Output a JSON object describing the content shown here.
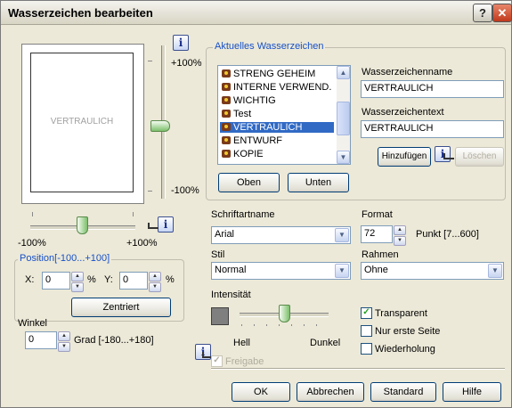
{
  "window": {
    "title": "Wasserzeichen bearbeiten",
    "help_label": "?",
    "close_label": "✕"
  },
  "info_icon": "i",
  "preview": {
    "watermark_text": "VERTRAULICH",
    "vertical_slider": {
      "max_label": "+100%",
      "min_label": "-100%",
      "value_percent": 0
    },
    "horizontal_slider": {
      "min_label": "-100%",
      "max_label": "+100%",
      "value_percent": 0
    }
  },
  "position": {
    "legend": "Position[-100...+100]",
    "x_label": "X:",
    "x_value": "0",
    "x_unit": "%",
    "y_label": "Y:",
    "y_value": "0",
    "y_unit": "%",
    "center_button": "Zentriert"
  },
  "angle": {
    "label": "Winkel",
    "value": "0",
    "unit_label": "Grad [-180...+180]"
  },
  "current": {
    "legend": "Aktuelles Wasserzeichen",
    "items": [
      {
        "label": "STRENG GEHEIM"
      },
      {
        "label": "INTERNE VERWEND."
      },
      {
        "label": "WICHTIG"
      },
      {
        "label": "Test"
      },
      {
        "label": "VERTRAULICH"
      },
      {
        "label": "ENTWURF"
      },
      {
        "label": "KOPIE"
      }
    ],
    "selected_index": 4,
    "top_button": "Oben",
    "bottom_button": "Unten",
    "name_label": "Wasserzeichenname",
    "name_value": "VERTRAULICH",
    "text_label": "Wasserzeichentext",
    "text_value": "VERTRAULICH",
    "add_button": "Hinzufügen",
    "delete_button": "Löschen"
  },
  "font": {
    "label": "Schriftartname",
    "value": "Arial"
  },
  "format": {
    "label": "Format",
    "value": "72",
    "unit_label": "Punkt [7...600]"
  },
  "style": {
    "label": "Stil",
    "value": "Normal"
  },
  "frame": {
    "label": "Rahmen",
    "value": "Ohne"
  },
  "intensity": {
    "label": "Intensität",
    "light_label": "Hell",
    "dark_label": "Dunkel",
    "value_percent": 30,
    "swatch_color": "#7f7f7f"
  },
  "options": {
    "transparent": {
      "label": "Transparent",
      "checked": true
    },
    "first_page_only": {
      "label": "Nur erste Seite",
      "checked": false
    },
    "repeat": {
      "label": "Wiederholung",
      "checked": false
    },
    "share": {
      "label": "Freigabe",
      "checked": true,
      "disabled": true
    }
  },
  "buttons": {
    "ok": "OK",
    "cancel": "Abbrechen",
    "standard": "Standard",
    "help": "Hilfe"
  },
  "colors": {
    "accent": "#1750c8",
    "selection": "#316ac5",
    "thumb_green": "#7cc06c"
  }
}
